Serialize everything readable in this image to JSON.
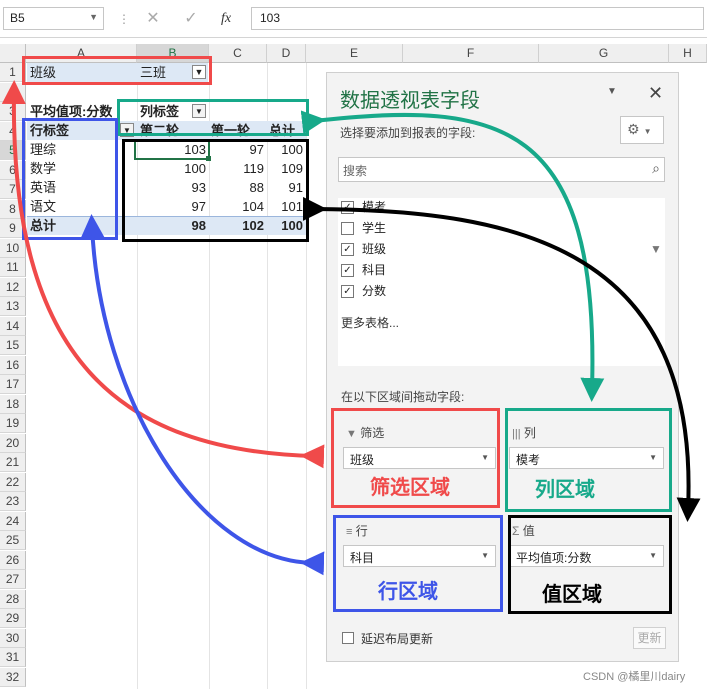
{
  "formula_bar": {
    "name_box": "B5",
    "cancel_icon": "✕",
    "enter_icon": "✓",
    "fx_label": "fx",
    "formula": "103"
  },
  "columns": [
    "A",
    "B",
    "C",
    "D",
    "E",
    "F",
    "G",
    "H"
  ],
  "rows": [
    "1",
    "2",
    "3",
    "4",
    "5",
    "6",
    "7",
    "8",
    "9",
    "10",
    "11",
    "12",
    "13",
    "14",
    "15",
    "16",
    "17",
    "18",
    "19",
    "20",
    "21",
    "22",
    "23",
    "24",
    "25",
    "26",
    "27",
    "28",
    "29",
    "30",
    "31",
    "32"
  ],
  "pivot": {
    "filter_label": "班级",
    "filter_value": "三班",
    "value_title": "平均值项:分数",
    "col_label_title": "列标签",
    "row_label_title": "行标签",
    "col_headers": [
      "第二轮",
      "第一轮",
      "总计"
    ],
    "rows": [
      {
        "label": "理综",
        "v1": "103",
        "v2": "97",
        "v3": "100"
      },
      {
        "label": "数学",
        "v1": "100",
        "v2": "119",
        "v3": "109"
      },
      {
        "label": "英语",
        "v1": "93",
        "v2": "88",
        "v3": "91"
      },
      {
        "label": "语文",
        "v1": "97",
        "v2": "104",
        "v3": "101"
      }
    ],
    "total": {
      "label": "总计",
      "v1": "98",
      "v2": "102",
      "v3": "100"
    }
  },
  "pane": {
    "title": "数据透视表字段",
    "choose_fields": "选择要添加到报表的字段:",
    "search_placeholder": "搜索",
    "fields": [
      {
        "label": "模考",
        "checked": "✓"
      },
      {
        "label": "学生",
        "checked": ""
      },
      {
        "label": "班级",
        "checked": "✓"
      },
      {
        "label": "科目",
        "checked": "✓"
      },
      {
        "label": "分数",
        "checked": "✓"
      }
    ],
    "more_tables": "更多表格...",
    "drag_between": "在以下区域间拖动字段:",
    "filter_area": {
      "title": "筛选",
      "value": "班级"
    },
    "columns_area": {
      "title": "列",
      "value": "模考"
    },
    "rows_area": {
      "title": "行",
      "value": "科目"
    },
    "values_area": {
      "title": "值",
      "value": "平均值项:分数"
    },
    "defer_update": "延迟布局更新",
    "update_button": "更新"
  },
  "annotations": {
    "filter_region": "筛选区域",
    "columns_region": "列区域",
    "rows_region": "行区域",
    "values_region": "值区域"
  },
  "watermark": "CSDN @橘里川dairy",
  "colors": {
    "red": "#f04a4a",
    "teal": "#17a98a",
    "blue": "#3e55e8",
    "black": "#000000",
    "excel_green": "#217346"
  }
}
